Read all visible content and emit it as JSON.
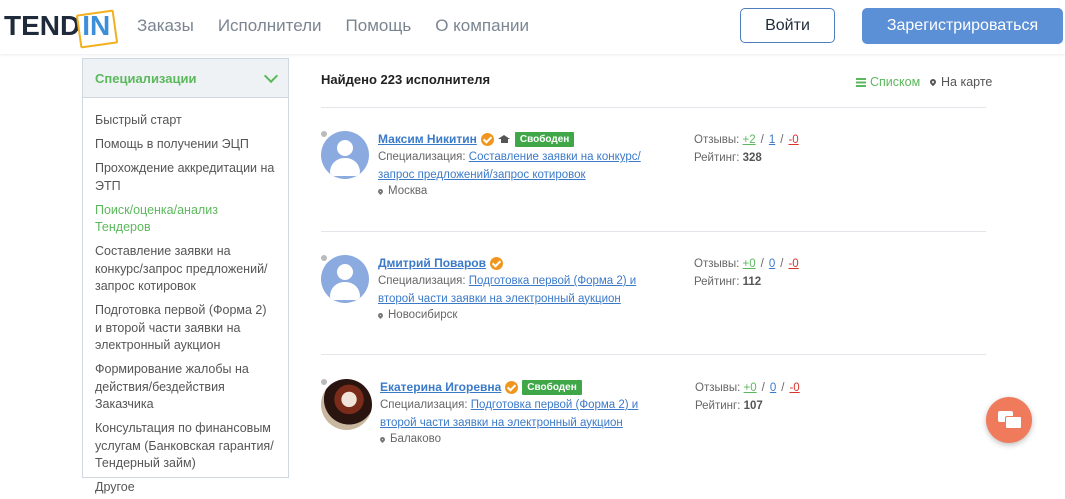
{
  "header": {
    "logo_left": "TEND",
    "logo_right": "IN",
    "nav": [
      "Заказы",
      "Исполнители",
      "Помощь",
      "О компании"
    ],
    "login_label": "Войти",
    "register_label": "Зарегистрироваться",
    "brand_color": "#5b8fd6"
  },
  "sidebar": {
    "title": "Специализации",
    "items": [
      "Быстрый старт",
      "Помощь в получении ЭЦП",
      "Прохождение аккредитации на ЭТП",
      "Поиск/оценка/анализ Тендеров",
      "Составление заявки на конкурс/запрос предложений/запрос котировок",
      "Подготовка первой (Форма 2) и второй части заявки на электронный аукцион",
      "Формирование жалобы на действия/бездействия Заказчика",
      "Консультация по финансовым услугам (Банковская гарантия/Тендерный займ)",
      "Другое"
    ],
    "active_index": 3,
    "accent_color": "#5cb85c"
  },
  "results": {
    "found_text": "Найдено 223 исполнителя",
    "view_list": "Списком",
    "view_map": "На карте",
    "spec_label": "Специализация:",
    "reviews_label": "Отзывы:",
    "rating_label": "Рейтинг:",
    "performers": [
      {
        "name": "Максим Никитин",
        "badge": "Свободен",
        "specialization": "Составление заявки на конкурс/запрос предложений/запрос котировок",
        "city": "Москва",
        "reviews_pos": "+2",
        "reviews_neu": "1",
        "reviews_neg": "-0",
        "rating": "328"
      },
      {
        "name": "Дмитрий Поваров",
        "badge": "",
        "specialization": "Подготовка первой (Форма 2) и второй части заявки на электронный аукцион",
        "city": "Новосибирск",
        "reviews_pos": "+0",
        "reviews_neu": "0",
        "reviews_neg": "-0",
        "rating": "112"
      },
      {
        "name": "Екатерина Игоревна",
        "badge": "Свободен",
        "specialization": "Подготовка первой (Форма 2) и второй части заявки на электронный аукцион",
        "city": "Балаково",
        "reviews_pos": "+0",
        "reviews_neu": "0",
        "reviews_neg": "-0",
        "rating": "107"
      }
    ]
  }
}
